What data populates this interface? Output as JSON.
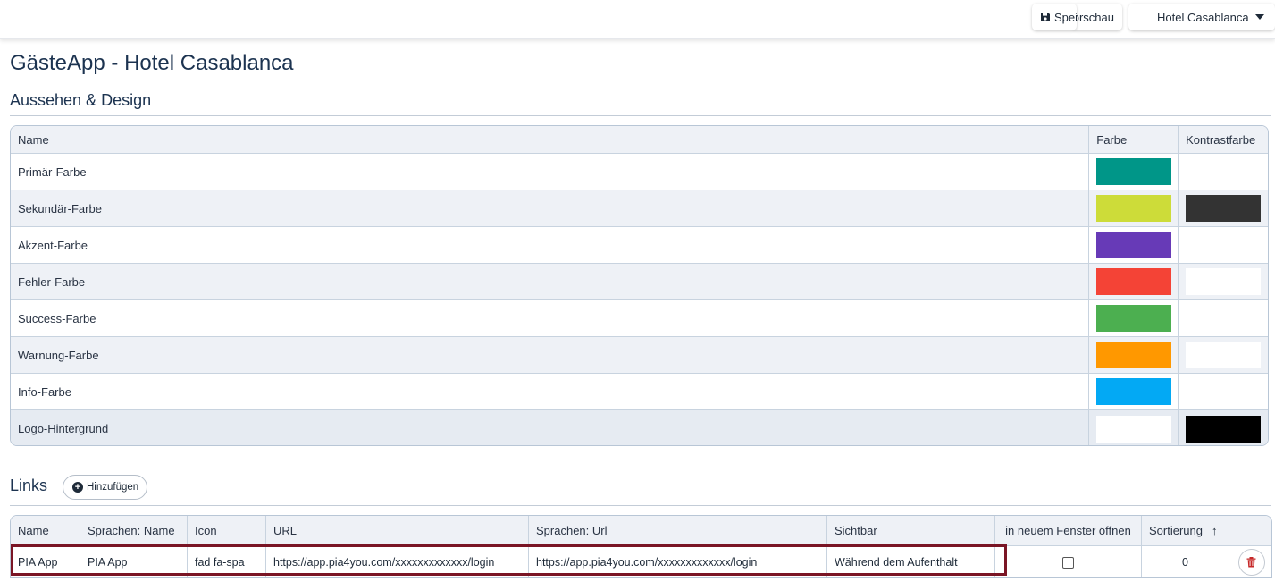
{
  "topbar": {
    "save_label": "Speichern",
    "preview_label": "Vorschau",
    "hotel_selector": "Hotel Casablanca"
  },
  "page_title": "GästeApp - Hotel Casablanca",
  "appearance": {
    "section_title": "Aussehen & Design",
    "columns": {
      "name": "Name",
      "color": "Farbe",
      "contrast": "Kontrastfarbe"
    },
    "rows": [
      {
        "name": "Primär-Farbe",
        "color": "#009688",
        "contrast": null
      },
      {
        "name": "Sekundär-Farbe",
        "color": "#CDDC39",
        "contrast": "#333333"
      },
      {
        "name": "Akzent-Farbe",
        "color": "#673AB7",
        "contrast": null
      },
      {
        "name": "Fehler-Farbe",
        "color": "#F44336",
        "contrast": "#FFFFFF"
      },
      {
        "name": "Success-Farbe",
        "color": "#4CAF50",
        "contrast": null
      },
      {
        "name": "Warnung-Farbe",
        "color": "#FF9800",
        "contrast": "#FFFFFF"
      },
      {
        "name": "Info-Farbe",
        "color": "#03A9F4",
        "contrast": null
      },
      {
        "name": "Logo-Hintergrund",
        "color": "#FFFFFF",
        "contrast": "#000000"
      }
    ]
  },
  "links": {
    "section_title": "Links",
    "add_button": "Hinzufügen",
    "columns": {
      "name": "Name",
      "lang_name": "Sprachen: Name",
      "icon": "Icon",
      "url": "URL",
      "lang_url": "Sprachen: Url",
      "visible": "Sichtbar",
      "new_window": "in neuem Fenster öffnen",
      "sort": "Sortierung"
    },
    "rows": [
      {
        "name": "PIA App",
        "lang_name": "PIA App",
        "icon": "fad fa-spa",
        "url": "https://app.pia4you.com/xxxxxxxxxxxxx/login",
        "lang_url": "https://app.pia4you.com/xxxxxxxxxxxxx/login",
        "visible": "Während dem Aufenthalt",
        "new_window": false,
        "sort": "0"
      }
    ]
  },
  "colors": {
    "brand_text": "#1c3350",
    "highlight_outline": "#7a1525",
    "delete_icon": "#c62828"
  }
}
